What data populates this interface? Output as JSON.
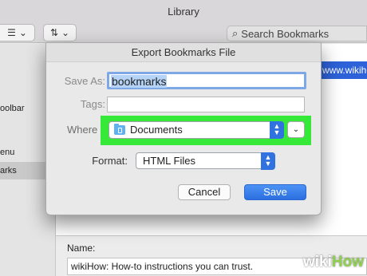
{
  "library": {
    "title": "Library",
    "search_placeholder": "Search Bookmarks",
    "sidebar": {
      "items": [
        {
          "label": "oolbar"
        },
        {
          "label": "enu"
        },
        {
          "label": "arks"
        }
      ]
    },
    "selected_url_fragment": "www.wikihov",
    "details": {
      "name_label": "Name:",
      "name_value": "wikiHow: How-to instructions you can trust."
    }
  },
  "dialog": {
    "title": "Export Bookmarks File",
    "save_as_label": "Save As:",
    "save_as_value": "bookmarks",
    "tags_label": "Tags:",
    "where_label": "Where",
    "where_value": "Documents",
    "format_label": "Format:",
    "format_value": "HTML Files",
    "cancel_label": "Cancel",
    "save_label": "Save"
  },
  "watermark": {
    "part1": "wiki",
    "part2": "How"
  },
  "colors": {
    "highlight": "#36e838",
    "accent": "#2f72e0"
  }
}
